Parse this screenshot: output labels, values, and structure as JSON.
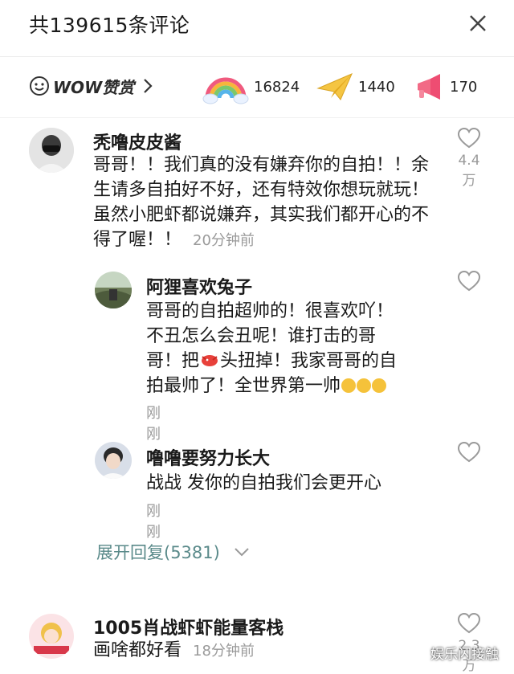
{
  "header": {
    "title": "共139615条评论"
  },
  "wow": {
    "label": "WOW赞赏",
    "reactions": [
      {
        "icon": "rainbow-icon",
        "count": "16824"
      },
      {
        "icon": "paper-plane-icon",
        "count": "1440"
      },
      {
        "icon": "megaphone-icon",
        "count": "170"
      }
    ]
  },
  "comments": [
    {
      "username": "秃噜皮皮酱",
      "lines": [
        "哥哥！！我们真的没有嫌弃你的自拍！！余",
        "生请多自拍好不好，还有特效你想玩就玩！",
        "虽然小肥虾都说嫌弃，其实我们都开心的不",
        "得了喔！！"
      ],
      "time": "20分钟前",
      "likes": "4.4万"
    }
  ],
  "replies": [
    {
      "username": "阿狸喜欢兔子",
      "lines": [
        "哥哥的自拍超帅的！很喜欢吖！",
        "不丑怎么会丑呢！谁打击的哥",
        "哥！把",
        "头扭掉！我家哥哥的自",
        "拍最帅了！全世界第一帅"
      ],
      "time": "刚刚"
    },
    {
      "username": "噜噜要努力长大",
      "lines": [
        "战战 发你的自拍我们会更开心"
      ],
      "time": "刚刚"
    }
  ],
  "expand": {
    "label": "展开回复(5381)"
  },
  "comment2": {
    "username": "1005肖战虾虾能量客栈",
    "text": "画啥都好看",
    "time": "18分钟前",
    "likes": "2.3万"
  },
  "watermark": "娱乐闪接触"
}
